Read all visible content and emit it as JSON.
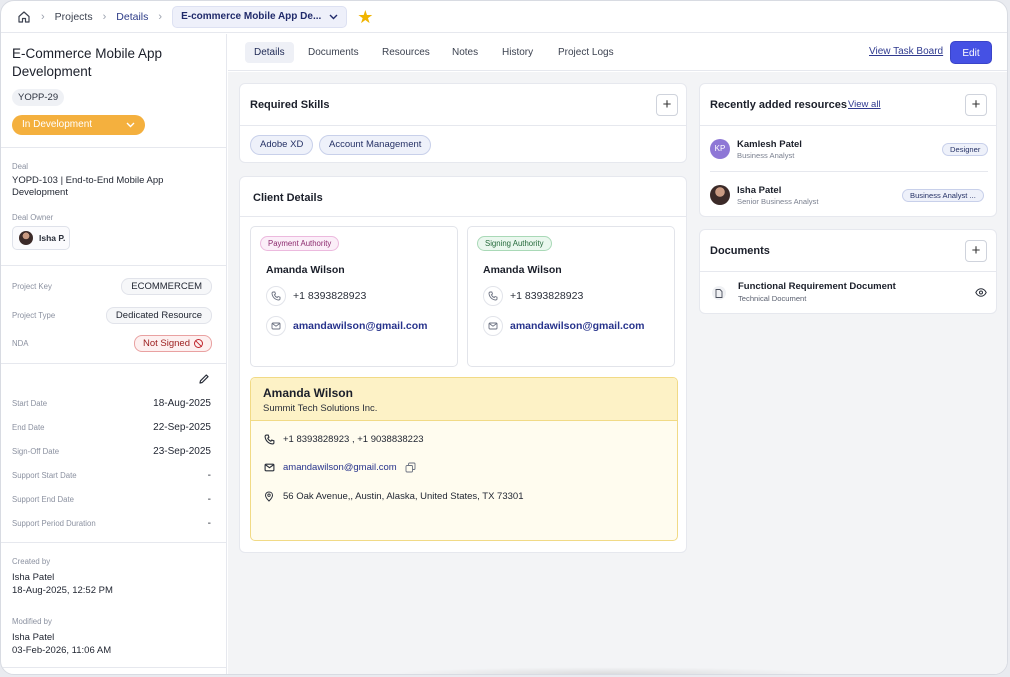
{
  "breadcrumb": {
    "home_icon": "home-icon",
    "items": [
      "Projects",
      "Details"
    ],
    "current": "E-commerce Mobile App De...",
    "star_icon": "star-icon"
  },
  "project": {
    "title": "E-Commerce Mobile App Development",
    "code": "YOPP-29",
    "status": "In Development",
    "status_color": "#f4b03e"
  },
  "deal": {
    "label": "Deal",
    "value": "YOPD-103 | End-to-End Mobile App Development",
    "owner_label": "Deal Owner",
    "owner_name": "Isha P."
  },
  "info": {
    "project_key_label": "Project Key",
    "project_key": "ECOMMERCEM",
    "project_type_label": "Project Type",
    "project_type": "Dedicated Resource",
    "nda_label": "NDA",
    "nda": "Not Signed"
  },
  "dates": [
    {
      "label": "Start Date",
      "value": "18-Aug-2025"
    },
    {
      "label": "End Date",
      "value": "22-Sep-2025"
    },
    {
      "label": "Sign-Off Date",
      "value": "23-Sep-2025"
    },
    {
      "label": "Support Start Date",
      "value": "-"
    },
    {
      "label": "Support End Date",
      "value": "-"
    },
    {
      "label": "Support Period Duration",
      "value": "-"
    }
  ],
  "audit": {
    "created_label": "Created by",
    "created_by": "Isha Patel",
    "created_at": "18-Aug-2025, 12:52 PM",
    "modified_label": "Modified by",
    "modified_by": "Isha Patel",
    "modified_at": "03-Feb-2026, 11:06 AM"
  },
  "tabs": [
    "Details",
    "Documents",
    "Resources",
    "Notes",
    "History",
    "Project Logs"
  ],
  "actions": {
    "view_task_board": "View Task Board",
    "edit": "Edit",
    "accent": "#4551e4"
  },
  "skills": {
    "title": "Required Skills",
    "items": [
      "Adobe XD",
      "Account Management"
    ]
  },
  "client": {
    "title": "Client Details",
    "contacts": [
      {
        "role": "Payment Authority",
        "name": "Amanda Wilson",
        "phone": "+1 8393828923",
        "email": "amandawilson@gmail.com"
      },
      {
        "role": "Signing Authority",
        "name": "Amanda Wilson",
        "phone": "+1 8393828923",
        "email": "amandawilson@gmail.com"
      }
    ],
    "primary": {
      "name": "Amanda Wilson",
      "company": "Summit Tech Solutions Inc.",
      "phones": "+1 8393828923 , +1 9038838223",
      "email": "amandawilson@gmail.com",
      "address": "56 Oak Avenue,, Austin, Alaska, United States, TX 73301"
    }
  },
  "resources": {
    "title": "Recently added resources",
    "view_all": "View all",
    "items": [
      {
        "initials": "KP",
        "name": "Kamlesh Patel",
        "role": "Business Analyst",
        "tag": "Designer"
      },
      {
        "initials": "",
        "name": "Isha Patel",
        "role": "Senior Business Analyst",
        "tag": "Business Analyst ..."
      }
    ]
  },
  "documents": {
    "title": "Documents",
    "items": [
      {
        "name": "Functional Requirement Document",
        "type": "Technical Document"
      }
    ]
  }
}
